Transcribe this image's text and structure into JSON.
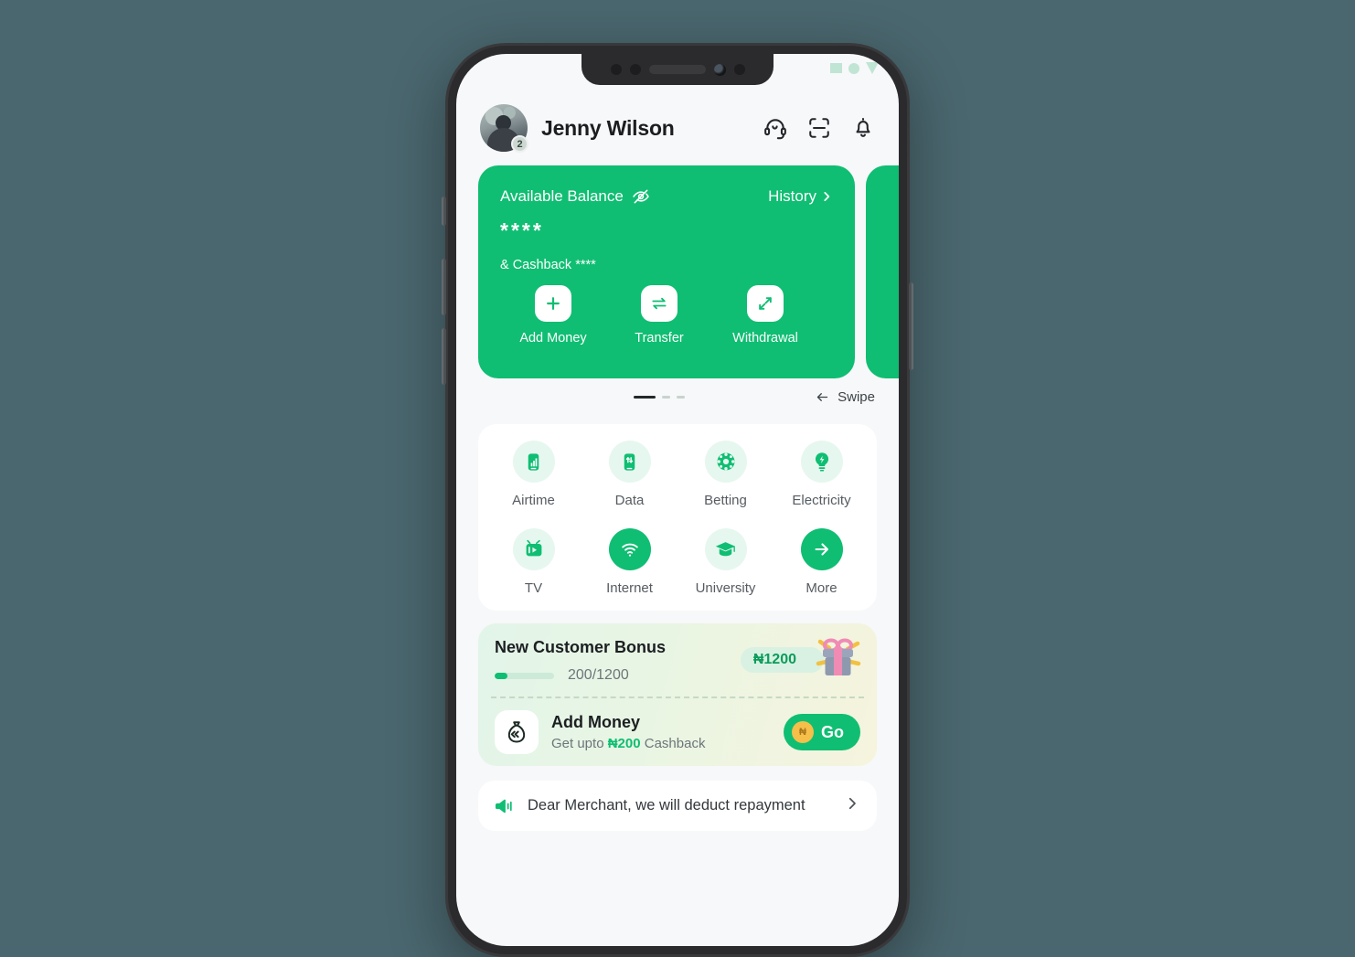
{
  "theme": {
    "page_background": "#4a666e",
    "brand_green": "#0fbe72",
    "screen_background": "#f7f8f9",
    "card_white": "#ffffff"
  },
  "status_bar": {
    "signal_icon": "signal-icon",
    "wifi_icon": "wifi-icon",
    "battery_icon": "battery-icon"
  },
  "header": {
    "avatar_icon": "avatar",
    "avatar_badge": "2",
    "user_name": "Jenny Wilson",
    "actions": [
      {
        "icon": "headset-icon",
        "name": "customer-service-button"
      },
      {
        "icon": "scan-icon",
        "name": "scan-button"
      },
      {
        "icon": "bell-icon",
        "name": "notifications-button"
      }
    ]
  },
  "balance_card": {
    "label": "Available Balance",
    "eye_icon": "eye-off-icon",
    "history_label": "History",
    "history_chevron": "chevron-right-icon",
    "amount": "****",
    "cashback_text": "& Cashback ****",
    "actions": [
      {
        "label": "Add Money",
        "icon": "plus-icon"
      },
      {
        "label": "Transfer",
        "icon": "transfer-arrows-icon"
      },
      {
        "label": "Withdrawal",
        "icon": "arrow-out-icon"
      }
    ]
  },
  "carousel": {
    "dots_total": 3,
    "active_index": 0,
    "swipe_label": "Swipe",
    "swipe_arrow_icon": "arrow-left-icon"
  },
  "services": {
    "row1": [
      {
        "label": "Airtime",
        "icon": "airtime-signal-icon"
      },
      {
        "label": "Data",
        "icon": "data-transfer-icon"
      },
      {
        "label": "Betting",
        "icon": "betting-ball-icon"
      },
      {
        "label": "Electricity",
        "icon": "bulb-bolt-icon"
      }
    ],
    "row2": [
      {
        "label": "TV",
        "icon": "tv-icon"
      },
      {
        "label": "Internet",
        "icon": "wifi-icon"
      },
      {
        "label": "University",
        "icon": "graduation-cap-icon"
      },
      {
        "label": "More",
        "icon": "arrow-right-circle-icon"
      }
    ]
  },
  "bonus": {
    "title": "New Customer Bonus",
    "progress_current": 200,
    "progress_total": 1200,
    "progress_text": "200/1200",
    "progress_percent": 22,
    "reward_amount": "₦1200",
    "gift_icon": "gift-box-icon",
    "offer": {
      "icon": "money-bag-icon",
      "title": "Add Money",
      "subtitle_prefix": "Get upto ",
      "subtitle_amount": "₦200",
      "subtitle_suffix": " Cashback",
      "button_label": "Go",
      "button_coin_icon": "naira-coin-icon"
    }
  },
  "notice": {
    "icon": "megaphone-icon",
    "text": "Dear Merchant, we will deduct repayment",
    "chevron": "chevron-right-icon"
  }
}
